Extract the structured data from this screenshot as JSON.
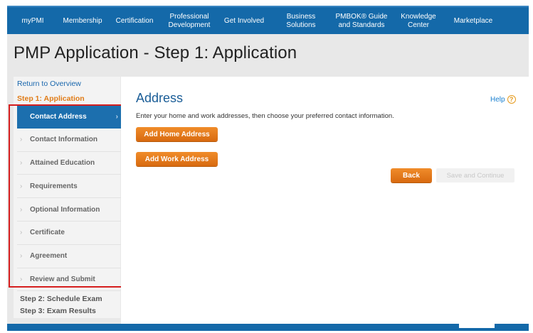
{
  "nav": {
    "items": [
      {
        "label": "myPMI"
      },
      {
        "label": "Membership"
      },
      {
        "label": "Certification"
      },
      {
        "label": "Professional\nDevelopment"
      },
      {
        "label": "Get Involved"
      },
      {
        "label": "Business\nSolutions"
      },
      {
        "label": "PMBOK® Guide\nand Standards"
      },
      {
        "label": "Knowledge\nCenter"
      },
      {
        "label": "Marketplace"
      }
    ]
  },
  "page": {
    "title": "PMP Application - Step 1: Application"
  },
  "sidebar": {
    "return_link": "Return to Overview",
    "current_step": "Step 1: Application",
    "substeps": [
      {
        "label": "Contact Address"
      },
      {
        "label": "Contact Information"
      },
      {
        "label": "Attained Education"
      },
      {
        "label": "Requirements"
      },
      {
        "label": "Optional Information"
      },
      {
        "label": "Certificate"
      },
      {
        "label": "Agreement"
      },
      {
        "label": "Review and Submit"
      }
    ],
    "step2": "Step 2: Schedule Exam",
    "step3": "Step 3: Exam Results"
  },
  "main": {
    "section_title": "Address",
    "help_label": "Help",
    "help_icon": "?",
    "instructions": "Enter your home and work addresses, then choose your preferred contact information.",
    "add_home_label": "Add Home Address",
    "add_work_label": "Add Work Address",
    "back_label": "Back",
    "save_label": "Save and Continue"
  },
  "colors": {
    "nav_blue": "#1469a9",
    "accent_orange": "#e07b16",
    "highlight_red": "#d51e1e"
  }
}
